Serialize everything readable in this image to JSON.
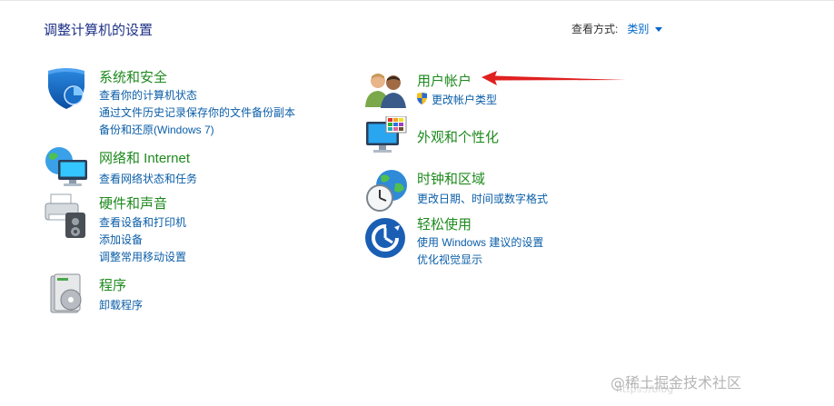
{
  "page_title": "调整计算机的设置",
  "view_by": {
    "label": "查看方式:",
    "value": "类别"
  },
  "categories": {
    "security": {
      "icon": "shield-icon",
      "title": "系统和安全",
      "links": [
        "查看你的计算机状态",
        "通过文件历史记录保存你的文件备份副本",
        "备份和还原(Windows 7)"
      ]
    },
    "network": {
      "icon": "globe-network-icon",
      "title": "网络和 Internet",
      "links": [
        "查看网络状态和任务"
      ]
    },
    "hardware": {
      "icon": "printer-sound-icon",
      "title": "硬件和声音",
      "links": [
        "查看设备和打印机",
        "添加设备",
        "调整常用移动设置"
      ]
    },
    "programs": {
      "icon": "programs-icon",
      "title": "程序",
      "links": [
        "卸载程序"
      ]
    },
    "user_accounts": {
      "icon": "users-icon",
      "title": "用户帐户",
      "links": [
        "更改帐户类型"
      ]
    },
    "appearance": {
      "icon": "appearance-icon",
      "title": "外观和个性化",
      "links": []
    },
    "clock": {
      "icon": "clock-globe-icon",
      "title": "时钟和区域",
      "links": [
        "更改日期、时间或数字格式"
      ]
    },
    "ease": {
      "icon": "ease-of-access-icon",
      "title": "轻松使用",
      "links": [
        "使用 Windows 建议的设置",
        "优化视觉显示"
      ]
    }
  },
  "colors": {
    "accent_link": "#0b5ea8",
    "category_title": "#1e8a1e",
    "page_title": "#1e3287",
    "arrow": "#e02020"
  },
  "watermark": {
    "text": "@稀土掘金技术社区",
    "faint": "https://blog"
  }
}
